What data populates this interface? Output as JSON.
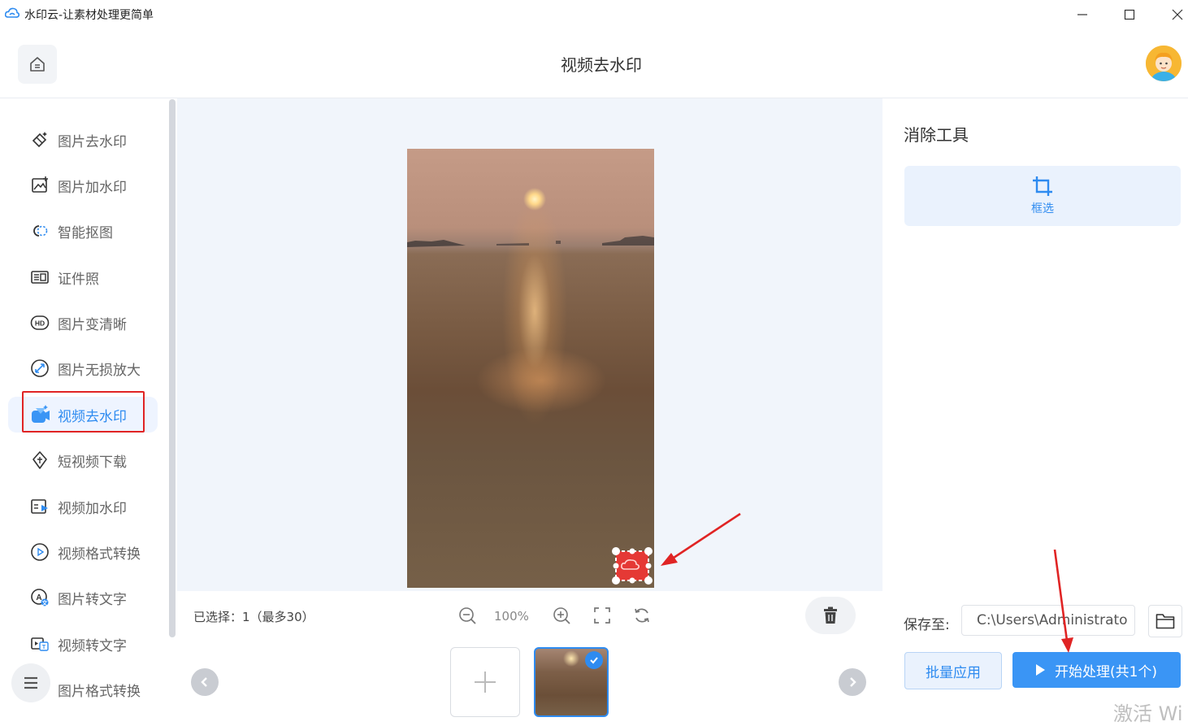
{
  "window": {
    "title": "水印云-让素材处理更简单",
    "minimize_glyph": "—",
    "maximize_glyph": "☐",
    "close_glyph": "✕"
  },
  "header": {
    "page_title": "视频去水印",
    "home_icon": "home-icon",
    "avatar": "user-avatar"
  },
  "sidebar": {
    "items": [
      {
        "label": "图片去水印",
        "icon": "eraser-icon"
      },
      {
        "label": "图片加水印",
        "icon": "image-add-icon"
      },
      {
        "label": "智能抠图",
        "icon": "cutout-icon"
      },
      {
        "label": "证件照",
        "icon": "id-card-icon"
      },
      {
        "label": "图片变清晰",
        "icon": "hd-icon"
      },
      {
        "label": "图片无损放大",
        "icon": "enlarge-icon"
      },
      {
        "label": "视频去水印",
        "icon": "video-eraser-icon",
        "active": true
      },
      {
        "label": "短视频下载",
        "icon": "download-link-icon"
      },
      {
        "label": "视频加水印",
        "icon": "video-add-icon"
      },
      {
        "label": "视频格式转换",
        "icon": "play-circle-icon"
      },
      {
        "label": "图片转文字",
        "icon": "image-text-icon"
      },
      {
        "label": "视频转文字",
        "icon": "video-text-icon"
      },
      {
        "label": "图片格式转换",
        "icon": "image-format-icon"
      }
    ],
    "menu_icon": "menu-icon"
  },
  "toolbar": {
    "selected_text": "已选择：1（最多30）",
    "zoom_level": "100%"
  },
  "right_panel": {
    "title": "消除工具",
    "frame_tool_label": "框选",
    "save_label": "保存至:",
    "save_path": "C:\\Users\\Administrato",
    "batch_button": "批量应用",
    "start_button": "开始处理(共1个)"
  },
  "os_watermark": "激活 Wi",
  "colors": {
    "accent": "#2e8bf0",
    "annotation": "#e02424"
  }
}
